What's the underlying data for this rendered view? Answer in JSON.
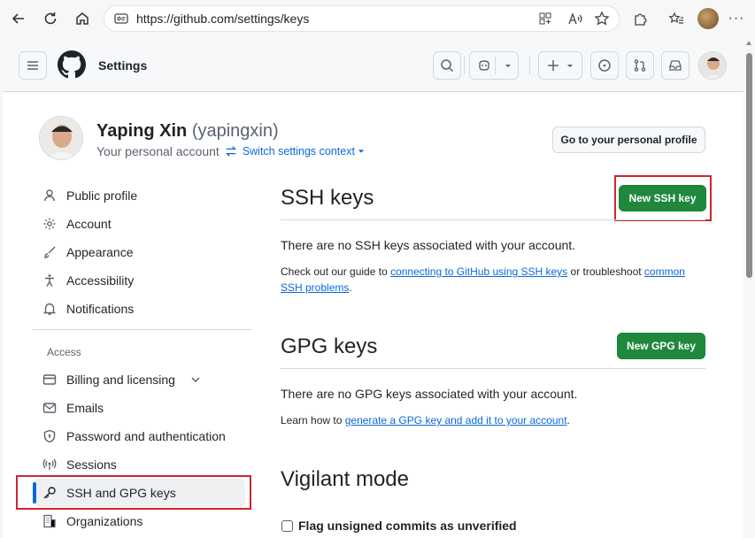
{
  "browser": {
    "url": "https://github.com/settings/keys"
  },
  "header": {
    "title": "Settings"
  },
  "profile": {
    "name": "Yaping Xin",
    "handle": "(yapingxin)",
    "subtitle": "Your personal account",
    "switch_label": "Switch settings context",
    "profile_button": "Go to your personal profile"
  },
  "sidebar": {
    "items": [
      {
        "label": "Public profile",
        "icon": "person-icon"
      },
      {
        "label": "Account",
        "icon": "gear-icon"
      },
      {
        "label": "Appearance",
        "icon": "paintbrush-icon"
      },
      {
        "label": "Accessibility",
        "icon": "accessibility-icon"
      },
      {
        "label": "Notifications",
        "icon": "bell-icon"
      }
    ],
    "access_heading": "Access",
    "access_items": [
      {
        "label": "Billing and licensing",
        "icon": "credit-card-icon"
      },
      {
        "label": "Emails",
        "icon": "mail-icon"
      },
      {
        "label": "Password and authentication",
        "icon": "shield-lock-icon"
      },
      {
        "label": "Sessions",
        "icon": "broadcast-icon"
      },
      {
        "label": "SSH and GPG keys",
        "icon": "key-icon"
      },
      {
        "label": "Organizations",
        "icon": "organization-icon"
      }
    ]
  },
  "ssh": {
    "title": "SSH keys",
    "button": "New SSH key",
    "empty": "There are no SSH keys associated with your account.",
    "guide_prefix": "Check out our guide to ",
    "guide_link1": "connecting to GitHub using SSH keys",
    "guide_mid": " or troubleshoot ",
    "guide_link2": "common SSH problems",
    "guide_suffix": "."
  },
  "gpg": {
    "title": "GPG keys",
    "button": "New GPG key",
    "empty": "There are no GPG keys associated with your account.",
    "learn_prefix": "Learn how to ",
    "learn_link": "generate a GPG key and add it to your account",
    "learn_suffix": "."
  },
  "vigilant": {
    "title": "Vigilant mode",
    "checkbox_label": "Flag unsigned commits as unverified"
  },
  "colors": {
    "accent": "#0969da",
    "primary_button": "#1f883d",
    "highlight": "#d0242f"
  }
}
